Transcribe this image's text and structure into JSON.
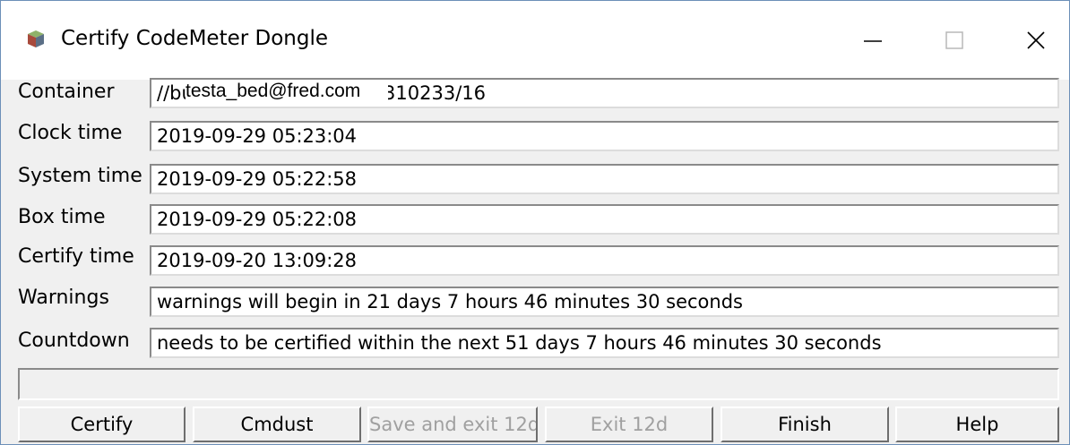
{
  "window": {
    "title": "Certify CodeMeter Dongle",
    "icons": {
      "app": "codemeter-app-icon",
      "minimize": "minimize-icon",
      "maximize": "maximize-icon",
      "close": "close-icon"
    }
  },
  "fields": {
    "container": {
      "label": "Container",
      "value": "//build-12d.12d.com/2-2310233/16",
      "overlay": "testa_bed@fred.com"
    },
    "clock_time": {
      "label": "Clock time",
      "value": "2019-09-29 05:23:04"
    },
    "system_time": {
      "label": "System time",
      "value": "2019-09-29 05:22:58"
    },
    "box_time": {
      "label": "Box time",
      "value": "2019-09-29 05:22:08"
    },
    "certify_time": {
      "label": "Certify time",
      "value": "2019-09-20 13:09:28"
    },
    "warnings": {
      "label": "Warnings",
      "value": "warnings will begin in 21 days 7 hours 46 minutes 30 seconds"
    },
    "countdown": {
      "label": "Countdown",
      "value": "needs to be certified within the next 51 days 7 hours 46 minutes 30 seconds"
    }
  },
  "status_bar": {
    "text": ""
  },
  "buttons": {
    "certify": {
      "label": "Certify",
      "enabled": true
    },
    "cmdust": {
      "label": "Cmdust",
      "enabled": true
    },
    "save_exit": {
      "label": "Save and exit 12d",
      "enabled": false
    },
    "exit": {
      "label": "Exit 12d",
      "enabled": false
    },
    "finish": {
      "label": "Finish",
      "enabled": true
    },
    "help": {
      "label": "Help",
      "enabled": true
    }
  }
}
